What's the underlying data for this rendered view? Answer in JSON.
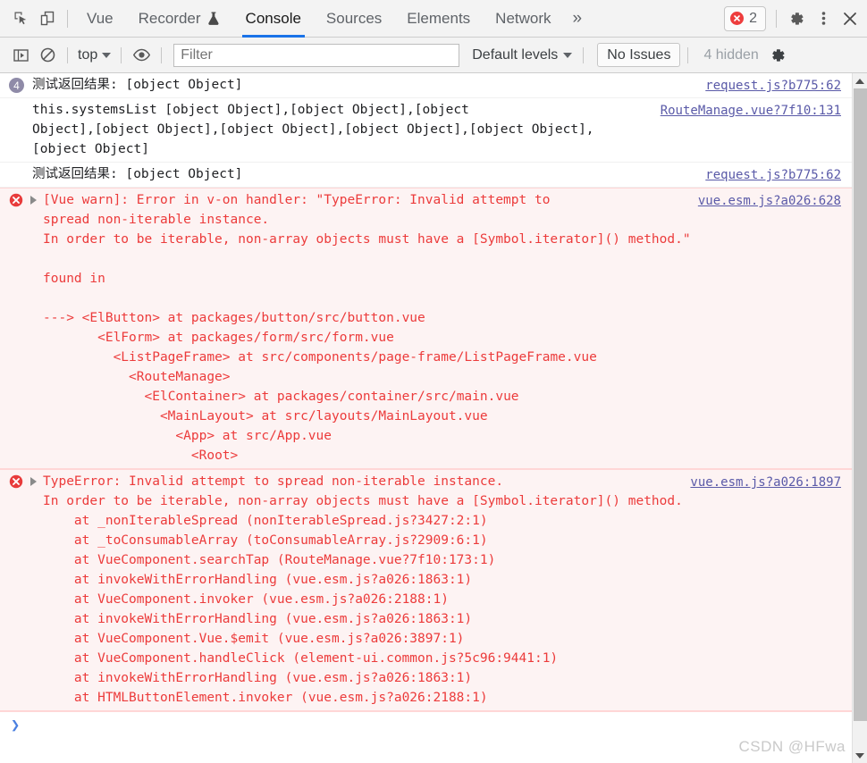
{
  "tabbar": {
    "inspect_icon": "inspect-cursor-icon",
    "device_icon": "device-toolbar-icon",
    "tabs": [
      {
        "label": "Vue",
        "active": false,
        "icon": null
      },
      {
        "label": "Recorder",
        "active": false,
        "icon": "flask-icon"
      },
      {
        "label": "Console",
        "active": true,
        "icon": null
      },
      {
        "label": "Sources",
        "active": false,
        "icon": null
      },
      {
        "label": "Elements",
        "active": false,
        "icon": null
      },
      {
        "label": "Network",
        "active": false,
        "icon": null
      }
    ],
    "more_tabs_label": "»",
    "error_badge": {
      "icon": "error-circle-icon",
      "count": "2"
    },
    "settings_icon": "gear-icon",
    "more_icon": "kebab-menu-icon",
    "close_icon": "close-icon"
  },
  "filterbar": {
    "sidebar_toggle_icon": "console-sidebar-icon",
    "clear_icon": "clear-console-icon",
    "context_selector": "top",
    "eye_icon": "live-expression-icon",
    "filter_placeholder": "Filter",
    "filter_value": "",
    "levels_label": "Default levels",
    "issues_label": "No Issues",
    "hidden_label": "4 hidden",
    "settings_icon": "gear-icon"
  },
  "console": {
    "messages": [
      {
        "kind": "log",
        "count": "4",
        "text": "测试返回结果: [object Object]",
        "source": "request.js?b775:62"
      },
      {
        "kind": "log",
        "count": null,
        "text": "this.systemsList [object Object],[object Object],[object\nObject],[object Object],[object Object],[object Object],[object Object],[object Object]",
        "source": "RouteManage.vue?7f10:131"
      },
      {
        "kind": "log",
        "count": null,
        "text": "测试返回结果: [object Object]",
        "source": "request.js?b775:62"
      },
      {
        "kind": "error",
        "count": null,
        "text": "[Vue warn]: Error in v-on handler: \"TypeError: Invalid attempt to\nspread non-iterable instance.\nIn order to be iterable, non-array objects must have a [Symbol.iterator]() method.\"\n\nfound in\n\n---> <ElButton> at packages/button/src/button.vue\n       <ElForm> at packages/form/src/form.vue\n         <ListPageFrame> at src/components/page-frame/ListPageFrame.vue\n           <RouteManage>\n             <ElContainer> at packages/container/src/main.vue\n               <MainLayout> at src/layouts/MainLayout.vue\n                 <App> at src/App.vue\n                   <Root>",
        "source": "vue.esm.js?a026:628"
      },
      {
        "kind": "error",
        "count": null,
        "text": "TypeError: Invalid attempt to spread non-iterable instance.\nIn order to be iterable, non-array objects must have a [Symbol.iterator]() method.\n    at _nonIterableSpread (nonIterableSpread.js?3427:2:1)\n    at _toConsumableArray (toConsumableArray.js?2909:6:1)\n    at VueComponent.searchTap (RouteManage.vue?7f10:173:1)\n    at invokeWithErrorHandling (vue.esm.js?a026:1863:1)\n    at VueComponent.invoker (vue.esm.js?a026:2188:1)\n    at invokeWithErrorHandling (vue.esm.js?a026:1863:1)\n    at VueComponent.Vue.$emit (vue.esm.js?a026:3897:1)\n    at VueComponent.handleClick (element-ui.common.js?5c96:9441:1)\n    at invokeWithErrorHandling (vue.esm.js?a026:1863:1)\n    at HTMLButtonElement.invoker (vue.esm.js?a026:2188:1)",
        "source": "vue.esm.js?a026:1897"
      }
    ],
    "prompt_symbol": "❯"
  },
  "watermark": "CSDN @HFwa",
  "colors": {
    "error_red": "#ec3b3b",
    "error_bg": "#fdf3f3",
    "link_purple": "#5a5aa8",
    "accent_blue": "#1a73e8",
    "toolbar_bg": "#f3f3f3",
    "count_badge": "#8f8ba8"
  }
}
